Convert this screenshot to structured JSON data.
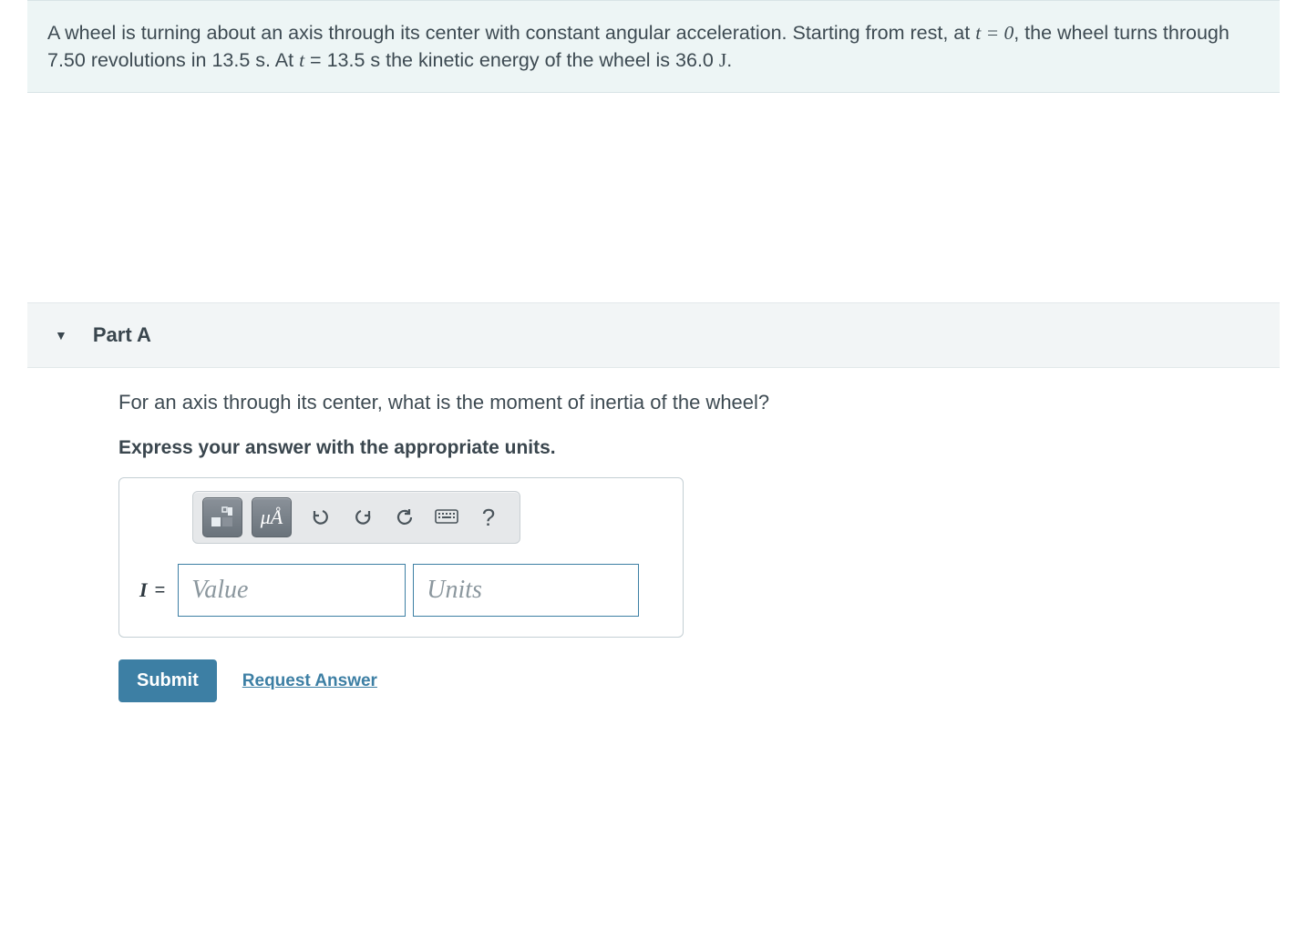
{
  "problem": {
    "text_pre": "A wheel is turning about an axis through its center with constant angular acceleration. Starting from rest, at ",
    "t_eq_0": "t = 0",
    "text_mid1": ", the wheel turns through 7.50 revolutions in 13.5 s. At ",
    "t_var": "t",
    "text_mid2": " = 13.5 s the kinetic energy of the wheel is 36.0 ",
    "j_unit": "J",
    "text_end": "."
  },
  "part": {
    "label": "Part A",
    "question": "For an axis through its center, what is the moment of inertia of the wheel?",
    "instruction": "Express your answer with the appropriate units."
  },
  "answer": {
    "variable": "I",
    "equals": "=",
    "value_placeholder": "Value",
    "units_placeholder": "Units"
  },
  "toolbar": {
    "template_button": "template",
    "mu_a": "μÅ",
    "undo": "↶",
    "redo": "↷",
    "reset": "↻",
    "keyboard": "⌨",
    "help": "?"
  },
  "actions": {
    "submit": "Submit",
    "request": "Request Answer"
  }
}
